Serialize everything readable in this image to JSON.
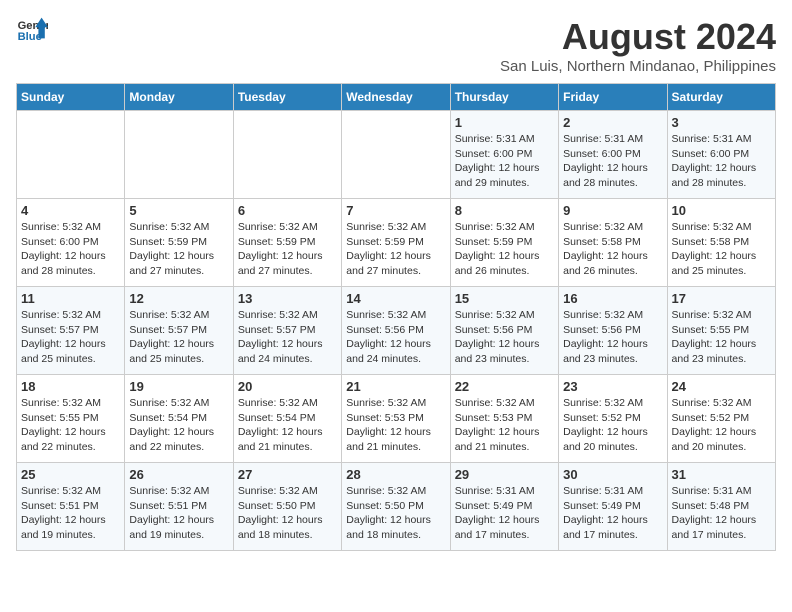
{
  "logo": {
    "line1": "General",
    "line2": "Blue"
  },
  "title": "August 2024",
  "location": "San Luis, Northern Mindanao, Philippines",
  "weekdays": [
    "Sunday",
    "Monday",
    "Tuesday",
    "Wednesday",
    "Thursday",
    "Friday",
    "Saturday"
  ],
  "weeks": [
    [
      {
        "day": "",
        "info": ""
      },
      {
        "day": "",
        "info": ""
      },
      {
        "day": "",
        "info": ""
      },
      {
        "day": "",
        "info": ""
      },
      {
        "day": "1",
        "info": "Sunrise: 5:31 AM\nSunset: 6:00 PM\nDaylight: 12 hours\nand 29 minutes."
      },
      {
        "day": "2",
        "info": "Sunrise: 5:31 AM\nSunset: 6:00 PM\nDaylight: 12 hours\nand 28 minutes."
      },
      {
        "day": "3",
        "info": "Sunrise: 5:31 AM\nSunset: 6:00 PM\nDaylight: 12 hours\nand 28 minutes."
      }
    ],
    [
      {
        "day": "4",
        "info": "Sunrise: 5:32 AM\nSunset: 6:00 PM\nDaylight: 12 hours\nand 28 minutes."
      },
      {
        "day": "5",
        "info": "Sunrise: 5:32 AM\nSunset: 5:59 PM\nDaylight: 12 hours\nand 27 minutes."
      },
      {
        "day": "6",
        "info": "Sunrise: 5:32 AM\nSunset: 5:59 PM\nDaylight: 12 hours\nand 27 minutes."
      },
      {
        "day": "7",
        "info": "Sunrise: 5:32 AM\nSunset: 5:59 PM\nDaylight: 12 hours\nand 27 minutes."
      },
      {
        "day": "8",
        "info": "Sunrise: 5:32 AM\nSunset: 5:59 PM\nDaylight: 12 hours\nand 26 minutes."
      },
      {
        "day": "9",
        "info": "Sunrise: 5:32 AM\nSunset: 5:58 PM\nDaylight: 12 hours\nand 26 minutes."
      },
      {
        "day": "10",
        "info": "Sunrise: 5:32 AM\nSunset: 5:58 PM\nDaylight: 12 hours\nand 25 minutes."
      }
    ],
    [
      {
        "day": "11",
        "info": "Sunrise: 5:32 AM\nSunset: 5:57 PM\nDaylight: 12 hours\nand 25 minutes."
      },
      {
        "day": "12",
        "info": "Sunrise: 5:32 AM\nSunset: 5:57 PM\nDaylight: 12 hours\nand 25 minutes."
      },
      {
        "day": "13",
        "info": "Sunrise: 5:32 AM\nSunset: 5:57 PM\nDaylight: 12 hours\nand 24 minutes."
      },
      {
        "day": "14",
        "info": "Sunrise: 5:32 AM\nSunset: 5:56 PM\nDaylight: 12 hours\nand 24 minutes."
      },
      {
        "day": "15",
        "info": "Sunrise: 5:32 AM\nSunset: 5:56 PM\nDaylight: 12 hours\nand 23 minutes."
      },
      {
        "day": "16",
        "info": "Sunrise: 5:32 AM\nSunset: 5:56 PM\nDaylight: 12 hours\nand 23 minutes."
      },
      {
        "day": "17",
        "info": "Sunrise: 5:32 AM\nSunset: 5:55 PM\nDaylight: 12 hours\nand 23 minutes."
      }
    ],
    [
      {
        "day": "18",
        "info": "Sunrise: 5:32 AM\nSunset: 5:55 PM\nDaylight: 12 hours\nand 22 minutes."
      },
      {
        "day": "19",
        "info": "Sunrise: 5:32 AM\nSunset: 5:54 PM\nDaylight: 12 hours\nand 22 minutes."
      },
      {
        "day": "20",
        "info": "Sunrise: 5:32 AM\nSunset: 5:54 PM\nDaylight: 12 hours\nand 21 minutes."
      },
      {
        "day": "21",
        "info": "Sunrise: 5:32 AM\nSunset: 5:53 PM\nDaylight: 12 hours\nand 21 minutes."
      },
      {
        "day": "22",
        "info": "Sunrise: 5:32 AM\nSunset: 5:53 PM\nDaylight: 12 hours\nand 21 minutes."
      },
      {
        "day": "23",
        "info": "Sunrise: 5:32 AM\nSunset: 5:52 PM\nDaylight: 12 hours\nand 20 minutes."
      },
      {
        "day": "24",
        "info": "Sunrise: 5:32 AM\nSunset: 5:52 PM\nDaylight: 12 hours\nand 20 minutes."
      }
    ],
    [
      {
        "day": "25",
        "info": "Sunrise: 5:32 AM\nSunset: 5:51 PM\nDaylight: 12 hours\nand 19 minutes."
      },
      {
        "day": "26",
        "info": "Sunrise: 5:32 AM\nSunset: 5:51 PM\nDaylight: 12 hours\nand 19 minutes."
      },
      {
        "day": "27",
        "info": "Sunrise: 5:32 AM\nSunset: 5:50 PM\nDaylight: 12 hours\nand 18 minutes."
      },
      {
        "day": "28",
        "info": "Sunrise: 5:32 AM\nSunset: 5:50 PM\nDaylight: 12 hours\nand 18 minutes."
      },
      {
        "day": "29",
        "info": "Sunrise: 5:31 AM\nSunset: 5:49 PM\nDaylight: 12 hours\nand 17 minutes."
      },
      {
        "day": "30",
        "info": "Sunrise: 5:31 AM\nSunset: 5:49 PM\nDaylight: 12 hours\nand 17 minutes."
      },
      {
        "day": "31",
        "info": "Sunrise: 5:31 AM\nSunset: 5:48 PM\nDaylight: 12 hours\nand 17 minutes."
      }
    ]
  ]
}
